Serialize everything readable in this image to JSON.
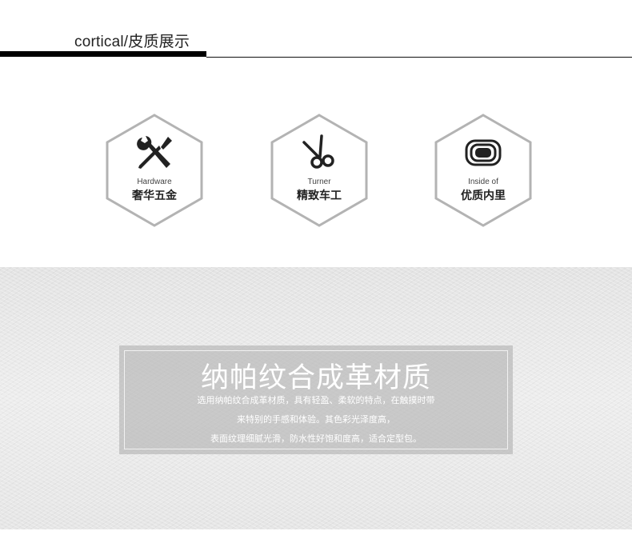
{
  "header": {
    "title": "cortical/皮质展示"
  },
  "features": [
    {
      "en": "Hardware",
      "zh": "奢华五金",
      "icon": "wrench-screwdriver-icon"
    },
    {
      "en": "Turner",
      "zh": "精致车工",
      "icon": "scissors-icon"
    },
    {
      "en": "Inside of",
      "zh": "优质内里",
      "icon": "lining-icon"
    }
  ],
  "leather": {
    "title": "纳帕纹合成革材质",
    "lines": [
      "选用纳帕纹合成革材质，具有轻盈、柔软的特点，在触摸时带",
      "来特别的手感和体验。其色彩光泽度高，",
      "表面纹理细腻光滑，防水性好饱和度高，适合定型包。"
    ]
  },
  "colors": {
    "hex_border": "#b3b3b3",
    "icon": "#222222",
    "box": "#b2b2b2",
    "leather_bg": "#eaeaea"
  }
}
